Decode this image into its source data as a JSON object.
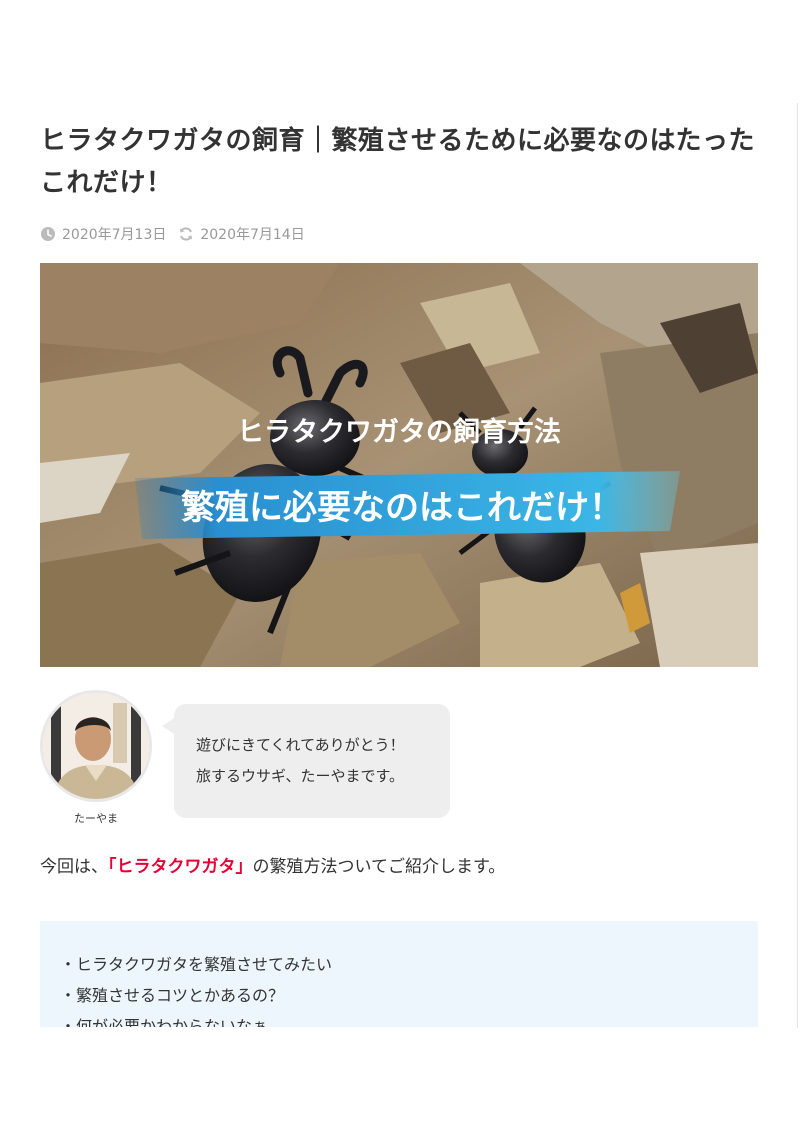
{
  "article": {
    "title": "ヒラタクワガタの飼育｜繁殖させるために必要なのはたったこれだけ！",
    "published_date": "2020年7月13日",
    "updated_date": "2020年7月14日"
  },
  "eyecatch": {
    "heading": "ヒラタクワガタの飼育方法",
    "banner": "繁殖に必要なのはこれだけ！"
  },
  "speech": {
    "name": "たーやま",
    "lines": [
      "遊びにきてくれてありがとう！",
      "旅するウサギ、たーやまです。"
    ]
  },
  "intro": {
    "before": "今回は、",
    "highlight": "「ヒラタクワガタ」",
    "after": "の繁殖方法ついてご紹介します。"
  },
  "checklist": {
    "items": [
      "・ヒラタクワガタを繁殖させてみたい",
      "・繁殖させるコツとかあるの？",
      "・何が必要かわからないなぁ"
    ]
  },
  "colors": {
    "highlight": "#e60033",
    "box_bg": "#eef6fd",
    "meta_text": "#999999",
    "banner": "#33aadd"
  },
  "icons": {
    "published": "clock-icon",
    "updated": "refresh-icon"
  }
}
